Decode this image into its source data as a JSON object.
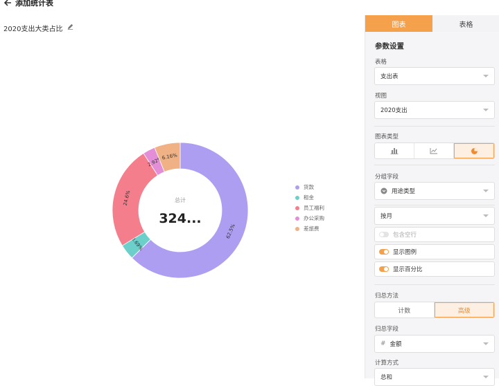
{
  "header": {
    "title": "添加统计表"
  },
  "chart_title": "2020支出大类占比",
  "donut": {
    "center_label": "总计",
    "center_value": "324..."
  },
  "chart_data": {
    "type": "pie",
    "donut": true,
    "series": [
      {
        "name": "货款",
        "value": 62.5,
        "label": "62.5%",
        "color": "#ae9ef1"
      },
      {
        "name": "租金",
        "value": 3.69,
        "label": "3.69%",
        "color": "#6ccfca"
      },
      {
        "name": "员工福利",
        "value": 24.6,
        "label": "24.6%",
        "color": "#f47e8c"
      },
      {
        "name": "办公采购",
        "value": 2.92,
        "label": "2.92%",
        "color": "#e38ed7"
      },
      {
        "name": "差旅费",
        "value": 6.16,
        "label": "6.16%",
        "color": "#f0b184"
      }
    ],
    "legend_position": "right"
  },
  "panel": {
    "tabs": [
      {
        "label": "图表",
        "active": true
      },
      {
        "label": "表格",
        "active": false
      }
    ],
    "section_title": "参数设置",
    "table_label": "表格",
    "table_value": "支出表",
    "view_label": "视图",
    "view_value": "2020支出",
    "chart_type_label": "图表类型",
    "chart_types": [
      "bar-chart-icon",
      "line-chart-icon",
      "pie-chart-icon"
    ],
    "group_label": "分组字段",
    "group_value": "用途类型",
    "period_value": "按月",
    "toggles": [
      {
        "label": "包含空行",
        "on": false
      },
      {
        "label": "显示图例",
        "on": true
      },
      {
        "label": "显示百分比",
        "on": true
      }
    ],
    "agg_method_label": "归总方法",
    "agg_methods": [
      {
        "label": "计数",
        "active": false
      },
      {
        "label": "高级",
        "active": true
      }
    ],
    "agg_field_label": "归总字段",
    "agg_field_value": "金额",
    "calc_label": "计算方式",
    "calc_value": "总和"
  },
  "colors": {
    "accent": "#f5a04a"
  }
}
